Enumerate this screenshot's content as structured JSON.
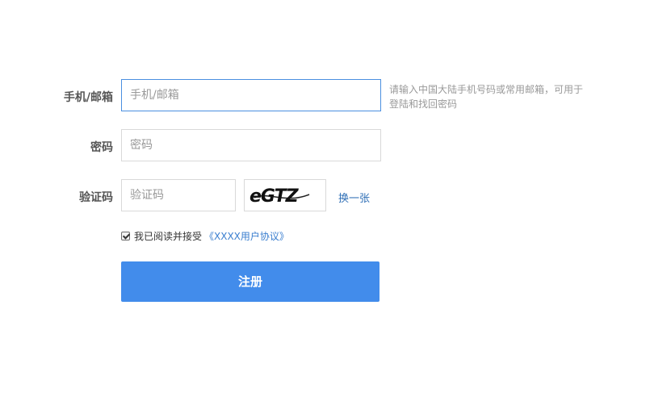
{
  "form": {
    "account": {
      "label": "手机/邮箱",
      "placeholder": "手机/邮箱",
      "hint": "请输入中国大陆手机号码或常用邮箱，可用于登陆和找回密码"
    },
    "password": {
      "label": "密码",
      "placeholder": "密码"
    },
    "captcha": {
      "label": "验证码",
      "placeholder": "验证码",
      "image_text": "eGTZ",
      "refresh_label": "换一张"
    },
    "agreement": {
      "checked": true,
      "text": "我已阅读并接受",
      "link_text": "《XXXX用户协议》"
    },
    "submit_label": "注册"
  },
  "colors": {
    "primary": "#428ceb",
    "link": "#3a7ecf",
    "focus_border": "#4a8fe0"
  }
}
